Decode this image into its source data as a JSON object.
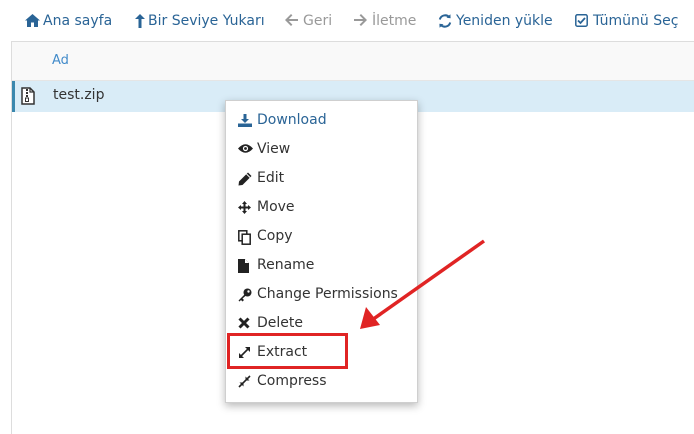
{
  "toolbar": {
    "items": [
      {
        "label": "Ana sayfa",
        "icon": "home-icon",
        "state": "active"
      },
      {
        "label": "Bir Seviye Yukarı",
        "icon": "level-up-icon",
        "state": "active"
      },
      {
        "label": "Geri",
        "icon": "arrow-left-icon",
        "state": "disabled"
      },
      {
        "label": "İletme",
        "icon": "arrow-right-icon",
        "state": "disabled"
      },
      {
        "label": "Yeniden yükle",
        "icon": "refresh-icon",
        "state": "active"
      },
      {
        "label": "Tümünü Seç",
        "icon": "check-square-icon",
        "state": "active"
      }
    ]
  },
  "file_list": {
    "column_name": "Ad",
    "rows": [
      {
        "name": "test.zip",
        "icon": "zip-file-icon",
        "selected": true
      }
    ]
  },
  "context_menu": {
    "items": [
      {
        "label": "Download",
        "icon": "download-icon"
      },
      {
        "label": "View",
        "icon": "eye-icon"
      },
      {
        "label": "Edit",
        "icon": "pencil-icon"
      },
      {
        "label": "Move",
        "icon": "move-icon"
      },
      {
        "label": "Copy",
        "icon": "copy-icon"
      },
      {
        "label": "Rename",
        "icon": "file-icon"
      },
      {
        "label": "Change Permissions",
        "icon": "key-icon"
      },
      {
        "label": "Delete",
        "icon": "delete-x-icon"
      },
      {
        "label": "Extract",
        "icon": "expand-icon",
        "highlighted": true
      },
      {
        "label": "Compress",
        "icon": "compress-icon"
      }
    ]
  },
  "colors": {
    "link": "#2a6496",
    "disabled": "#999999",
    "selected_row": "#d9ecf7",
    "annotation": "#e02424"
  }
}
